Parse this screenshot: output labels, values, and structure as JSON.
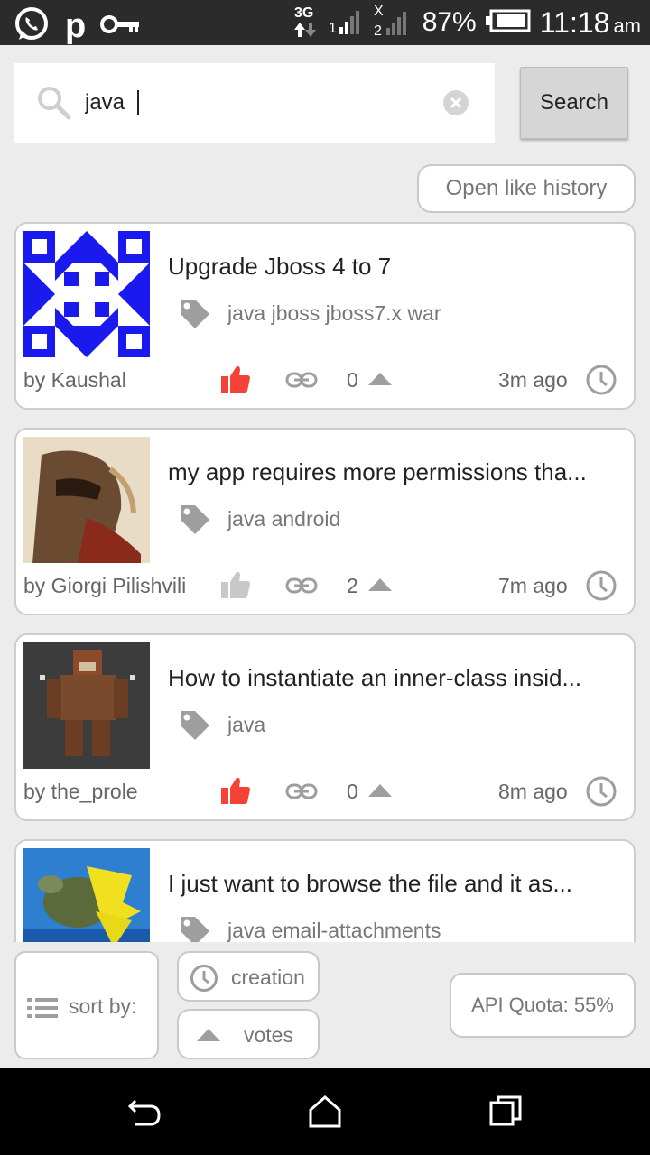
{
  "status_bar": {
    "network": "3G",
    "sim1": "1",
    "sim2": "2",
    "battery": "87%",
    "time": "11:18",
    "ampm": "am",
    "left_icons": [
      "whatsapp-icon",
      "p-icon",
      "key-icon"
    ]
  },
  "search": {
    "value": "java",
    "button_label": "Search"
  },
  "history_button": "Open like history",
  "questions": [
    {
      "title": "Upgrade Jboss 4 to 7",
      "tags": "java jboss jboss7.x war",
      "author": "by Kaushal",
      "votes": "0",
      "time": "3m ago",
      "liked": true,
      "avatar": "identicon-blue"
    },
    {
      "title": "my app requires more permissions tha...",
      "tags": "java android",
      "author": "by Giorgi Pilishvili",
      "votes": "2",
      "time": "7m ago",
      "liked": false,
      "avatar": "helmet-warrior"
    },
    {
      "title": "How to instantiate an inner-class insid...",
      "tags": "java",
      "author": "by the_prole",
      "votes": "0",
      "time": "8m ago",
      "liked": true,
      "avatar": "pixel-monster"
    },
    {
      "title": "I just want to browse the file and it as...",
      "tags": "java email-attachments",
      "author": "",
      "votes": "",
      "time": "",
      "liked": false,
      "avatar": "sea-turtle"
    }
  ],
  "toolbar": {
    "sort_label": "sort by:",
    "creation_label": "creation",
    "votes_label": "votes",
    "quota_label": "API Quota: 55%"
  },
  "colors": {
    "like_active": "#f44336",
    "like_inactive": "#c8c8c8",
    "icon_grey": "#9e9e9e",
    "identicon": "#1a1aee"
  }
}
